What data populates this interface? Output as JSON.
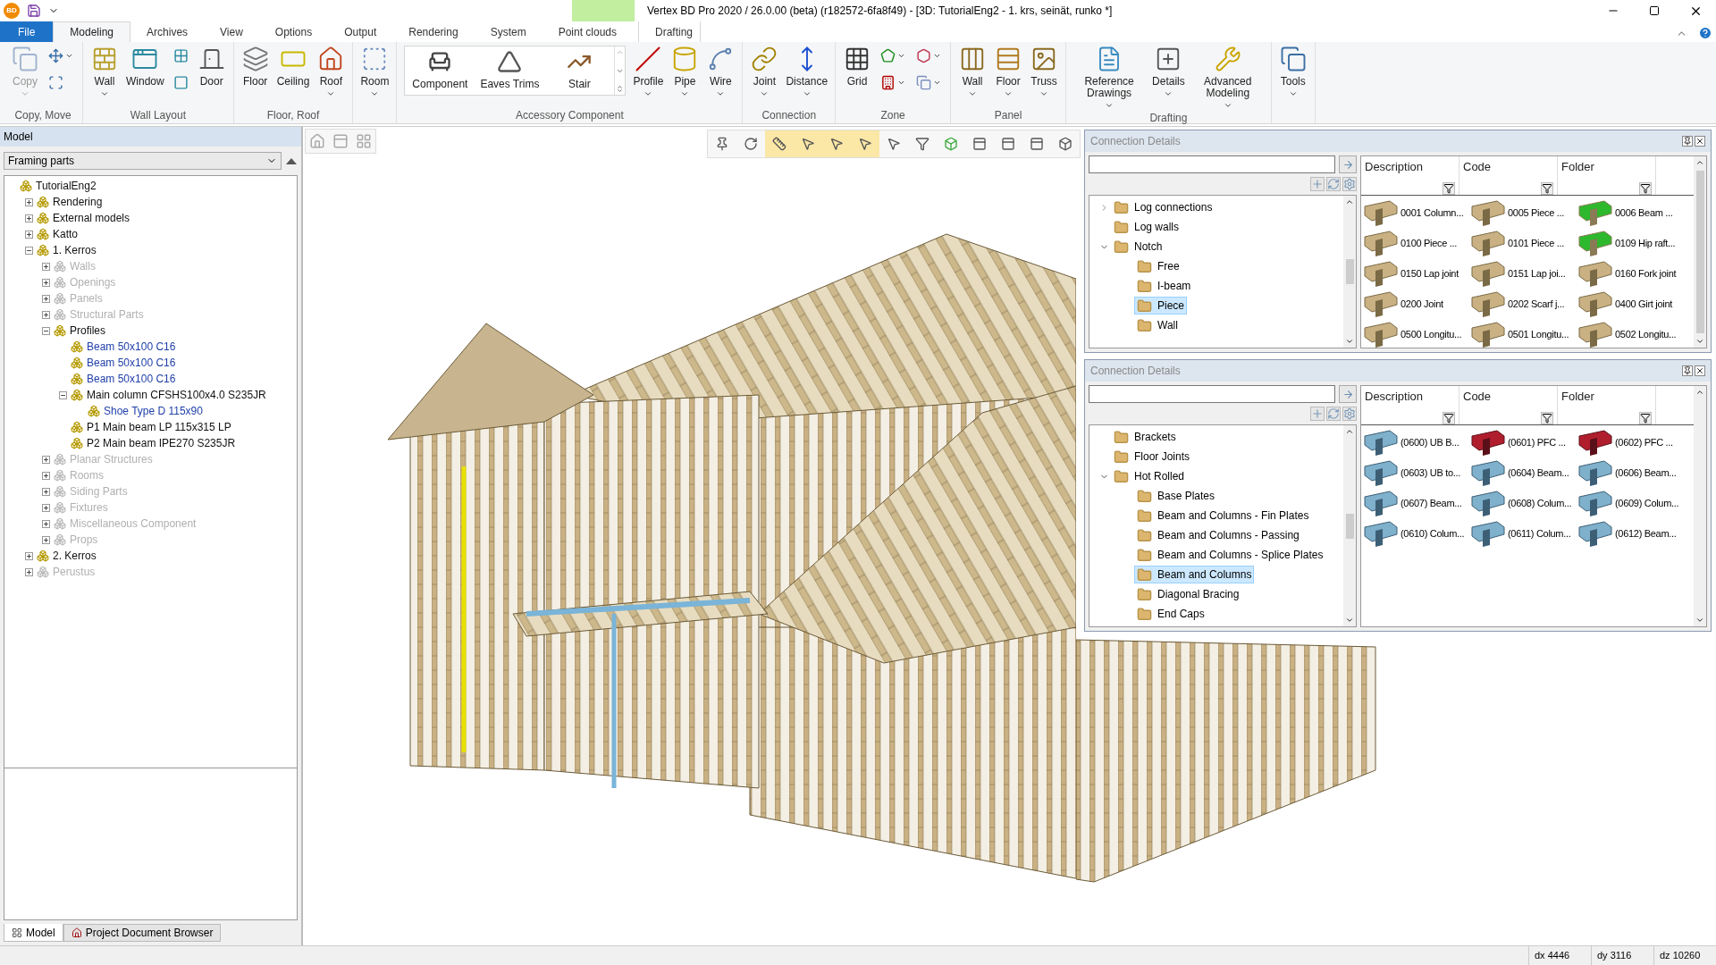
{
  "window": {
    "logo": "BD",
    "title": "Vertex BD Pro 2020 / 26.0.00 (beta) (r182572-6fa8f49) - [3D: TutorialEng2 - 1. krs, seinät, runko *]"
  },
  "ribbon_tabs": [
    {
      "label": "File",
      "kind": "file",
      "selected": false
    },
    {
      "label": "Modeling",
      "kind": "normal",
      "selected": true
    },
    {
      "label": "Archives",
      "kind": "normal",
      "selected": false
    },
    {
      "label": "View",
      "kind": "normal",
      "selected": false
    },
    {
      "label": "Options",
      "kind": "normal",
      "selected": false
    },
    {
      "label": "Output",
      "kind": "normal",
      "selected": false
    },
    {
      "label": "Rendering",
      "kind": "normal",
      "selected": false
    },
    {
      "label": "System",
      "kind": "normal",
      "selected": false
    },
    {
      "label": "Point clouds",
      "kind": "normal",
      "selected": false
    },
    {
      "label": "Drafting",
      "kind": "contextual",
      "selected": false
    }
  ],
  "ribbon_groups": [
    {
      "label": "Copy, Move",
      "buttons": [
        {
          "kind": "large",
          "label": "Copy",
          "dropdown": true,
          "disabled": true
        },
        {
          "kind": "small",
          "dropdown": true,
          "disabled": false
        },
        {
          "kind": "small",
          "dropdown": false,
          "disabled": false
        }
      ]
    },
    {
      "label": "Wall Layout",
      "buttons": [
        {
          "kind": "large",
          "label": "Wall",
          "dropdown": true,
          "disabled": false
        },
        {
          "kind": "large",
          "label": "Window",
          "dropdown": false,
          "disabled": false
        },
        {
          "kind": "small",
          "dropdown": false,
          "disabled": false
        },
        {
          "kind": "small",
          "dropdown": false,
          "disabled": false
        },
        {
          "kind": "large",
          "label": "Door",
          "dropdown": false,
          "disabled": false
        }
      ]
    },
    {
      "label": "Floor, Roof",
      "buttons": [
        {
          "kind": "large",
          "label": "Floor",
          "dropdown": false,
          "disabled": false
        },
        {
          "kind": "large",
          "label": "Ceiling",
          "dropdown": false,
          "disabled": false
        },
        {
          "kind": "large",
          "label": "Roof",
          "dropdown": true,
          "disabled": false
        }
      ]
    },
    {
      "buttons": [
        {
          "kind": "large",
          "label": "Room",
          "dropdown": true,
          "disabled": false
        }
      ]
    },
    {
      "label": "Accessory Component",
      "buttons": [
        {
          "kind": "gallery",
          "label": "Component",
          "disabled": false
        },
        {
          "kind": "gallery",
          "label": "Eaves Trims",
          "disabled": false
        },
        {
          "kind": "gallery",
          "label": "Stair",
          "disabled": false
        },
        {
          "kind": "large",
          "label": "Profile",
          "dropdown": true,
          "disabled": false
        },
        {
          "kind": "large",
          "label": "Pipe",
          "dropdown": true,
          "disabled": false
        },
        {
          "kind": "large",
          "label": "Wire",
          "dropdown": true,
          "disabled": false
        }
      ]
    },
    {
      "label": "Connection",
      "buttons": [
        {
          "kind": "large",
          "label": "Joint",
          "dropdown": true,
          "disabled": false
        },
        {
          "kind": "large",
          "label": "Distance",
          "dropdown": true,
          "disabled": false
        }
      ]
    },
    {
      "label": "Zone",
      "buttons": [
        {
          "kind": "large",
          "label": "Grid",
          "dropdown": false,
          "disabled": false
        },
        {
          "kind": "small",
          "dropdown": true,
          "disabled": false
        },
        {
          "kind": "small",
          "dropdown": true,
          "disabled": false
        },
        {
          "kind": "small",
          "dropdown": true,
          "disabled": false
        },
        {
          "kind": "small",
          "dropdown": true,
          "disabled": false
        }
      ]
    },
    {
      "label": "Panel",
      "buttons": [
        {
          "kind": "large",
          "label": "Wall",
          "dropdown": true,
          "disabled": false
        },
        {
          "kind": "large",
          "label": "Floor",
          "dropdown": true,
          "disabled": false
        },
        {
          "kind": "large",
          "label": "Truss",
          "dropdown": true,
          "disabled": false
        }
      ]
    },
    {
      "label": "Drafting",
      "buttons": [
        {
          "kind": "large",
          "label": "Reference Drawings",
          "dropdown": true,
          "disabled": false
        },
        {
          "kind": "large",
          "label": "Details",
          "dropdown": true,
          "disabled": false
        },
        {
          "kind": "large",
          "label": "Advanced Modeling",
          "dropdown": true,
          "disabled": false
        }
      ]
    },
    {
      "buttons": [
        {
          "kind": "large",
          "label": "Tools",
          "dropdown": true,
          "disabled": false
        }
      ]
    }
  ],
  "model_panel": {
    "title": "Model",
    "filter": "Framing parts",
    "tree": [
      {
        "label": "TutorialEng2",
        "dimmed": false,
        "kind": "node",
        "children": [
          {
            "label": "Rendering",
            "expanded": false,
            "dimmed": false,
            "kind": "node"
          },
          {
            "label": "External models",
            "expanded": false,
            "dimmed": false,
            "kind": "node"
          },
          {
            "label": "Katto",
            "expanded": false,
            "dimmed": false,
            "kind": "node"
          },
          {
            "label": "1. Kerros",
            "expanded": true,
            "dimmed": false,
            "kind": "node",
            "children": [
              {
                "label": "Walls",
                "expanded": false,
                "dimmed": true,
                "kind": "node"
              },
              {
                "label": "Openings",
                "expanded": false,
                "dimmed": true,
                "kind": "node"
              },
              {
                "label": "Panels",
                "expanded": false,
                "dimmed": true,
                "kind": "node"
              },
              {
                "label": "Structural Parts",
                "expanded": false,
                "dimmed": true,
                "kind": "node"
              },
              {
                "label": "Profiles",
                "expanded": true,
                "dimmed": false,
                "kind": "node",
                "children": [
                  {
                    "label": "Beam 50x100 C16",
                    "dimmed": false,
                    "kind": "part"
                  },
                  {
                    "label": "Beam 50x100 C16",
                    "dimmed": false,
                    "kind": "part"
                  },
                  {
                    "label": "Beam 50x100 C16",
                    "dimmed": false,
                    "kind": "part"
                  },
                  {
                    "label": "Main column CFSHS100x4.0 S235JR",
                    "expanded": true,
                    "dimmed": false,
                    "kind": "node",
                    "children": [
                      {
                        "label": "Shoe Type D 115x90",
                        "dimmed": false,
                        "kind": "part"
                      }
                    ]
                  },
                  {
                    "label": "P1 Main beam LP 115x315 LP",
                    "dimmed": false,
                    "kind": "node"
                  },
                  {
                    "label": "P2 Main beam IPE270 S235JR",
                    "dimmed": false,
                    "kind": "node"
                  }
                ]
              },
              {
                "label": "Planar Structures",
                "expanded": false,
                "dimmed": true,
                "kind": "node"
              },
              {
                "label": "Rooms",
                "expanded": false,
                "dimmed": true,
                "kind": "node"
              },
              {
                "label": "Siding Parts",
                "expanded": false,
                "dimmed": true,
                "kind": "node"
              },
              {
                "label": "Fixtures",
                "expanded": false,
                "dimmed": true,
                "kind": "node"
              },
              {
                "label": "Miscellaneous Component",
                "expanded": false,
                "dimmed": true,
                "kind": "node"
              },
              {
                "label": "Props",
                "expanded": false,
                "dimmed": true,
                "kind": "node"
              }
            ]
          },
          {
            "label": "2. Kerros",
            "expanded": false,
            "dimmed": false,
            "kind": "node"
          },
          {
            "label": "Perustus",
            "expanded": false,
            "dimmed": true,
            "kind": "node"
          }
        ]
      }
    ],
    "tabs": [
      {
        "label": "Model",
        "selected": true
      },
      {
        "label": "Project Document Browser",
        "selected": false
      }
    ]
  },
  "view_toolbar": [
    {
      "selected": false
    },
    {
      "selected": false
    },
    {
      "selected": true
    },
    {
      "selected": true
    },
    {
      "selected": true
    },
    {
      "selected": true
    },
    {
      "selected": false
    },
    {
      "selected": false
    },
    {
      "selected": false
    },
    {
      "selected": false
    },
    {
      "selected": false
    },
    {
      "selected": false
    },
    {
      "selected": false
    }
  ],
  "connection_panels": [
    {
      "title": "Connection Details",
      "columns": [
        "Description",
        "Code",
        "Folder"
      ],
      "tree": [
        {
          "label": "Log connections",
          "expanded": false,
          "selected": false
        },
        {
          "label": "Log walls",
          "selected": false
        },
        {
          "label": "Notch",
          "expanded": true,
          "selected": false,
          "children": [
            {
              "label": "Free",
              "selected": false
            },
            {
              "label": "I-beam",
              "selected": false
            },
            {
              "label": "Piece",
              "selected": true
            },
            {
              "label": "Wall",
              "selected": false
            }
          ]
        }
      ],
      "items": [
        {
          "label": "0001 Column...",
          "kind": "timber"
        },
        {
          "label": "0005 Piece ...",
          "kind": "timber"
        },
        {
          "label": "0006 Beam ...",
          "kind": "green"
        },
        {
          "label": "0100 Piece ...",
          "kind": "timber"
        },
        {
          "label": "0101 Piece ...",
          "kind": "timber"
        },
        {
          "label": "0109 Hip raft...",
          "kind": "green"
        },
        {
          "label": "0150 Lap joint",
          "kind": "timber"
        },
        {
          "label": "0151 Lap joi...",
          "kind": "timber"
        },
        {
          "label": "0160 Fork joint",
          "kind": "timber"
        },
        {
          "label": "0200 Joint",
          "kind": "timber"
        },
        {
          "label": "0202 Scarf j...",
          "kind": "timber"
        },
        {
          "label": "0400 Girt joint",
          "kind": "timber"
        },
        {
          "label": "0500 Longitu...",
          "kind": "timber"
        },
        {
          "label": "0501 Longitu...",
          "kind": "timber"
        },
        {
          "label": "0502 Longitu...",
          "kind": "timber"
        }
      ]
    },
    {
      "title": "Connection Details",
      "columns": [
        "Description",
        "Code",
        "Folder"
      ],
      "tree": [
        {
          "label": "Brackets",
          "selected": false
        },
        {
          "label": "Floor Joints",
          "selected": false
        },
        {
          "label": "Hot Rolled",
          "expanded": true,
          "selected": false,
          "children": [
            {
              "label": "Base Plates",
              "selected": false
            },
            {
              "label": "Beam and Columns - Fin Plates",
              "selected": false
            },
            {
              "label": "Beam and Columns - Passing",
              "selected": false
            },
            {
              "label": "Beam and Columns - Splice Plates",
              "selected": false
            },
            {
              "label": "Beam and Columns",
              "selected": true
            },
            {
              "label": "Diagonal Bracing",
              "selected": false
            },
            {
              "label": "End Caps",
              "selected": false
            }
          ]
        }
      ],
      "items": [
        {
          "label": "(0600) UB B...",
          "kind": "steel"
        },
        {
          "label": "(0601) PFC ...",
          "kind": "red"
        },
        {
          "label": "(0602) PFC ...",
          "kind": "red"
        },
        {
          "label": "(0603) UB to...",
          "kind": "steel"
        },
        {
          "label": "(0604) Beam...",
          "kind": "steel"
        },
        {
          "label": "(0606) Beam...",
          "kind": "steel"
        },
        {
          "label": "(0607) Beam...",
          "kind": "steel"
        },
        {
          "label": "(0608) Colum...",
          "kind": "steel"
        },
        {
          "label": "(0609) Colum...",
          "kind": "steel"
        },
        {
          "label": "(0610) Colum...",
          "kind": "steel"
        },
        {
          "label": "(0611) Colum...",
          "kind": "steel"
        },
        {
          "label": "(0612) Beam...",
          "kind": "steel"
        }
      ]
    }
  ],
  "status_bar": [
    "dx 4446",
    "dy 3116",
    "dz 10260"
  ]
}
